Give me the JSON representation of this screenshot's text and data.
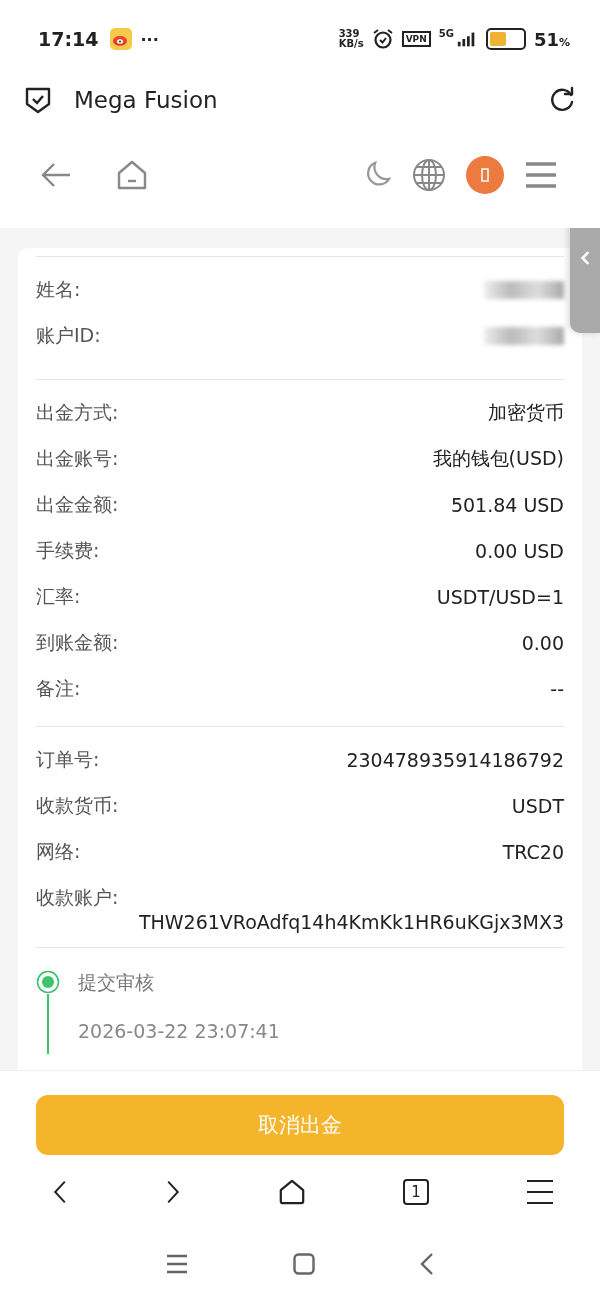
{
  "status_bar": {
    "time": "17:14",
    "more": "···",
    "speed_value": "339",
    "speed_unit": "KB/s",
    "vpn": "VPN",
    "network": "5G",
    "battery_text": "51",
    "battery_unit": "%"
  },
  "app_header": {
    "title": "Mega Fusion"
  },
  "sections": [
    {
      "rows": [
        {
          "kind": "redacted",
          "label": "姓名:"
        },
        {
          "kind": "redacted",
          "label": "账户ID:"
        }
      ]
    },
    {
      "rows": [
        {
          "kind": "field",
          "label": "出金方式:",
          "value": "加密货币"
        },
        {
          "kind": "field",
          "label": "出金账号:",
          "value": "我的钱包(USD)"
        },
        {
          "kind": "field",
          "label": "出金金额:",
          "value": "501.84 USD"
        },
        {
          "kind": "field",
          "label": "手续费:",
          "value": "0.00 USD"
        },
        {
          "kind": "field",
          "label": "汇率:",
          "value": "USDT/USD=1"
        },
        {
          "kind": "field",
          "label": "到账金额:",
          "value": "0.00"
        },
        {
          "kind": "field",
          "label": "备注:",
          "value": "--"
        }
      ]
    },
    {
      "rows": [
        {
          "kind": "field",
          "label": "订单号:",
          "value": "230478935914186792"
        },
        {
          "kind": "field",
          "label": "收款货币:",
          "value": "USDT"
        },
        {
          "kind": "field",
          "label": "网络:",
          "value": "TRC20"
        },
        {
          "kind": "stacked",
          "label": "收款账户:",
          "value": "THW261VRoAdfq14h4KmKk1HR6uKGjx3MX3"
        }
      ]
    }
  ],
  "timeline": [
    {
      "title": "提交审核",
      "time": "2026-03-22 23:07:41",
      "selected": true
    }
  ],
  "primary_button": "取消出金",
  "browser_nav": {
    "tab_count": "1"
  }
}
